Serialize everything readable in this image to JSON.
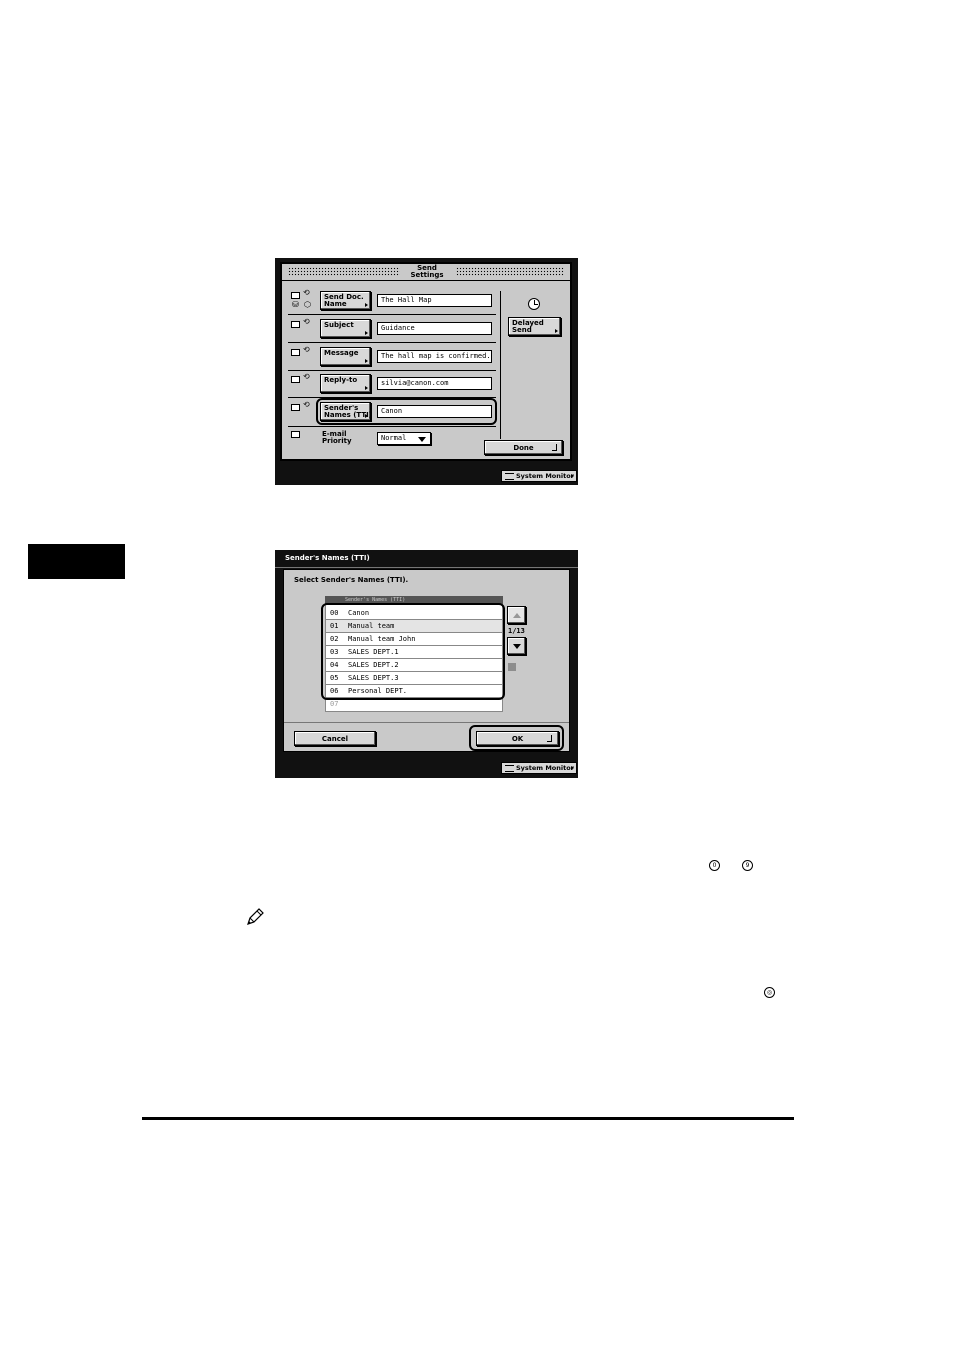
{
  "send_settings": {
    "title_line1": "Send",
    "title_line2": "Settings",
    "rows": [
      {
        "label_line1": "Send Doc.",
        "label_line2": "Name",
        "value": "The Hall Map"
      },
      {
        "label_line1": "Subject",
        "label_line2": "",
        "value": "Guidance"
      },
      {
        "label_line1": "Message",
        "label_line2": "",
        "value": "The hall map is confirmed."
      },
      {
        "label_line1": "Reply-to",
        "label_line2": "",
        "value": "silvia@canon.com"
      },
      {
        "label_line1": "Sender's",
        "label_line2": "Names (TTI)",
        "value": "Canon"
      }
    ],
    "priority_label_line1": "E-mail",
    "priority_label_line2": "Priority",
    "priority_value": "Normal",
    "delayed_line1": "Delayed",
    "delayed_line2": "Send",
    "done_label": "Done",
    "system_monitor": "System Monitor"
  },
  "senders_names": {
    "title": "Sender's Names (TTI)",
    "instruction": "Select Sender's Names (TTI).",
    "list_header": "Sender's Names (TTI)",
    "items": [
      {
        "num": "00",
        "name": "Canon"
      },
      {
        "num": "01",
        "name": "Manual team"
      },
      {
        "num": "02",
        "name": "Manual team John"
      },
      {
        "num": "03",
        "name": "SALES DEPT.1"
      },
      {
        "num": "04",
        "name": "SALES DEPT.2"
      },
      {
        "num": "05",
        "name": "SALES DEPT.3"
      },
      {
        "num": "06",
        "name": "Personal DEPT."
      }
    ],
    "partial_item": "07",
    "page_indicator": "1/13",
    "cancel_label": "Cancel",
    "ok_label": "OK",
    "system_monitor": "System Monitor"
  },
  "icons": {
    "key_icon_1": "0",
    "key_icon_2": "9",
    "key_icon_3": "◎"
  },
  "colors": {
    "panel_bg": "#111111",
    "screen_bg": "#c9c9c9",
    "tab_block": "#000000"
  }
}
